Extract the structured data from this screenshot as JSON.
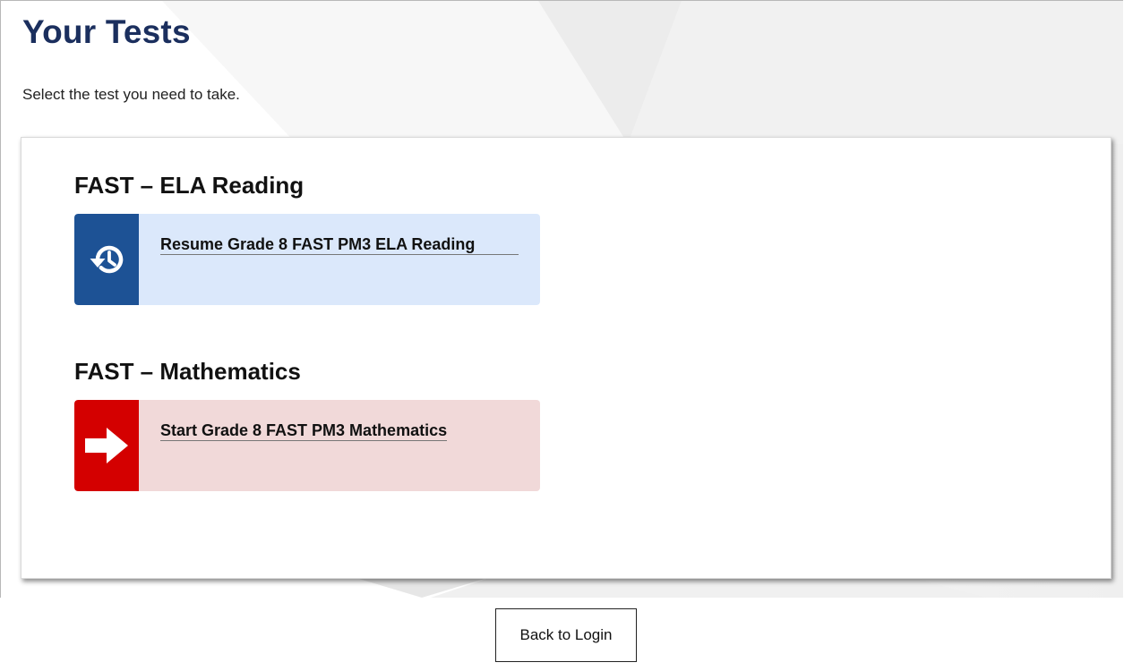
{
  "header": {
    "title": "Your Tests",
    "subtitle": "Select the test you need to take."
  },
  "sections": [
    {
      "heading": "FAST – ELA Reading",
      "tile": {
        "action": "resume",
        "label": "Resume Grade 8 FAST PM3 ELA Reading",
        "icon": "history-icon",
        "icon_color": "#1d5295",
        "background": "#dbe8fb"
      }
    },
    {
      "heading": "FAST – Mathematics",
      "tile": {
        "action": "start",
        "label": "Start Grade 8 FAST PM3 Mathematics",
        "icon": "arrow-right-icon",
        "icon_color": "#d40000",
        "background": "#f1d9d9"
      }
    }
  ],
  "footer": {
    "back_label": "Back to Login"
  },
  "colors": {
    "title": "#1b2f5e",
    "resume_accent": "#1d5295",
    "start_accent": "#d40000"
  }
}
